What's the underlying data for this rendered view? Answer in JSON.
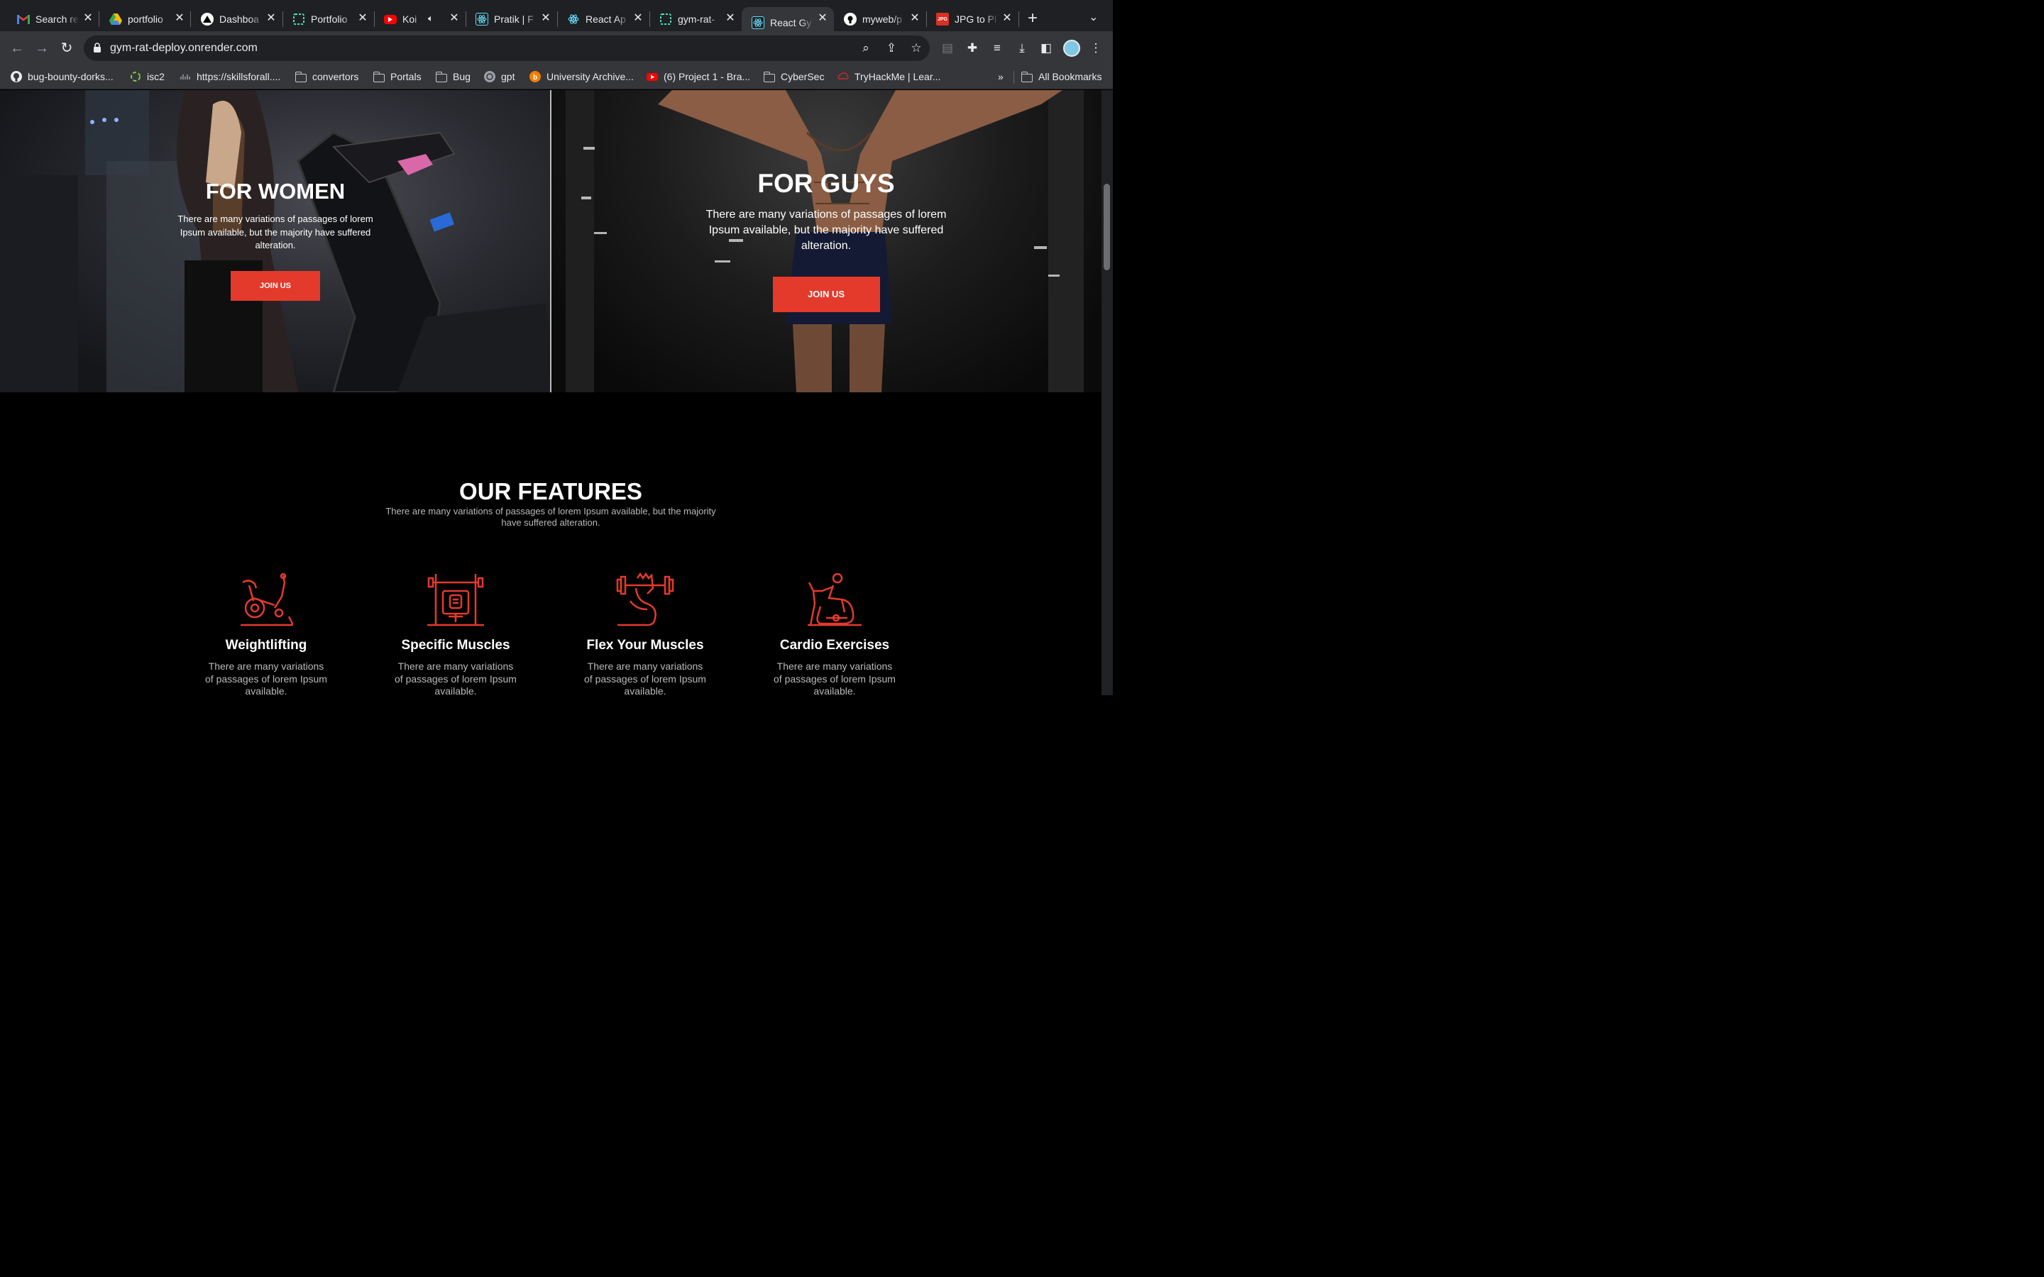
{
  "browser": {
    "tabs": [
      {
        "title": "Search re",
        "favicon": "gmail-icon",
        "color": "#ea4335"
      },
      {
        "title": "portfolio",
        "favicon": "google-drive-icon",
        "color": "#34a853"
      },
      {
        "title": "Dashboa",
        "favicon": "vercel-icon",
        "color": "#ffffff"
      },
      {
        "title": "Portfolio",
        "favicon": "render-icon",
        "color": "#46e3b7"
      },
      {
        "title": "Koi Tu",
        "favicon": "youtube-icon",
        "color": "#ff0000"
      },
      {
        "title": "Pratik | F",
        "favicon": "react-icon",
        "color": "#61dafb"
      },
      {
        "title": "React Ap",
        "favicon": "react-icon",
        "color": "#61dafb"
      },
      {
        "title": "gym-rat-",
        "favicon": "render-icon",
        "color": "#46e3b7"
      },
      {
        "title": "React Gy",
        "favicon": "react-icon",
        "color": "#61dafb"
      },
      {
        "title": "myweb/p",
        "favicon": "github-icon",
        "color": "#ffffff"
      },
      {
        "title": "JPG to Pl",
        "favicon": "jpg2png-icon",
        "color": "#d93025"
      }
    ],
    "active_tab_index": 8,
    "url": "gym-rat-deploy.onrender.com",
    "bookmarks": [
      {
        "label": "bug-bounty-dorks...",
        "icon": "github-icon"
      },
      {
        "label": "isc2",
        "icon": "isc2-icon"
      },
      {
        "label": "https://skillsforall....",
        "icon": "cisco-icon"
      },
      {
        "label": "convertors",
        "icon": "folder-icon"
      },
      {
        "label": "Portals",
        "icon": "folder-icon"
      },
      {
        "label": "Bug",
        "icon": "folder-icon"
      },
      {
        "label": "gpt",
        "icon": "openai-icon"
      },
      {
        "label": "University Archive...",
        "icon": "archive-icon"
      },
      {
        "label": "(6) Project 1 - Bra...",
        "icon": "youtube-icon"
      },
      {
        "label": "CyberSec",
        "icon": "folder-icon"
      },
      {
        "label": "TryHackMe | Lear...",
        "icon": "tryhackme-icon"
      }
    ],
    "overflow_label": "»",
    "all_bookmarks_label": "All Bookmarks"
  },
  "hero": {
    "women": {
      "title": "FOR WOMEN",
      "description": "There are many variations of passages of lorem Ipsum available, but the majority have suffered alteration.",
      "button": "JOIN US"
    },
    "guys": {
      "title": "FOR GUYS",
      "description": "There are many variations of passages of lorem Ipsum available, but the majority have suffered alteration.",
      "button": "JOIN US"
    }
  },
  "features": {
    "title": "OUR FEATURES",
    "description": "There are many variations of passages of lorem Ipsum available, but the majority have suffered alteration.",
    "items": [
      {
        "title": "Weightlifting",
        "description": "There are many variations of passages of lorem Ipsum available.",
        "icon": "exercise-bike-icon"
      },
      {
        "title": "Specific Muscles",
        "description": "There are many variations of passages of lorem Ipsum available.",
        "icon": "bench-press-icon"
      },
      {
        "title": "Flex Your Muscles",
        "description": "There are many variations of passages of lorem Ipsum available.",
        "icon": "flexing-arm-icon"
      },
      {
        "title": "Cardio Exercises",
        "description": "There are many variations of passages of lorem Ipsum available.",
        "icon": "cycling-person-icon"
      }
    ]
  },
  "colors": {
    "accent": "#e33a2c",
    "page_background": "#000000",
    "browser_chrome": "#35363a"
  }
}
